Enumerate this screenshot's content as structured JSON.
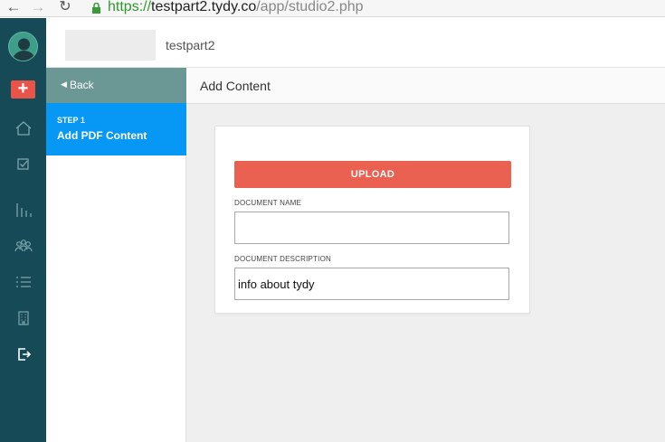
{
  "browser": {
    "back_glyph": "←",
    "forward_glyph": "→",
    "reload_glyph": "↻",
    "url_scheme": "https://",
    "url_host": "testpart2.tydy.co",
    "url_path": "/app/studio2.php"
  },
  "header": {
    "site_name": "testpart2"
  },
  "rail": {
    "add_glyph": "+",
    "icons": [
      "home-icon",
      "checkbox-icon",
      "bar-chart-icon",
      "users-icon",
      "list-icon",
      "building-icon",
      "logout-icon"
    ]
  },
  "steps": {
    "back_label": "Back",
    "back_glyph": "◀",
    "active_step": {
      "number_label": "STEP 1",
      "title": "Add PDF Content"
    }
  },
  "content": {
    "title": "Add Content",
    "upload_label": "UPLOAD",
    "document_name_label": "DOCUMENT NAME",
    "document_name_value": "",
    "document_description_label": "DOCUMENT DESCRIPTION",
    "document_description_value": "info about tydy"
  },
  "colors": {
    "rail_bg": "#164a57",
    "back_bar_bg": "#6b9795",
    "active_step_bg": "#0797f4",
    "upload_bg": "#ea6152",
    "add_button_bg": "#e9544a"
  }
}
